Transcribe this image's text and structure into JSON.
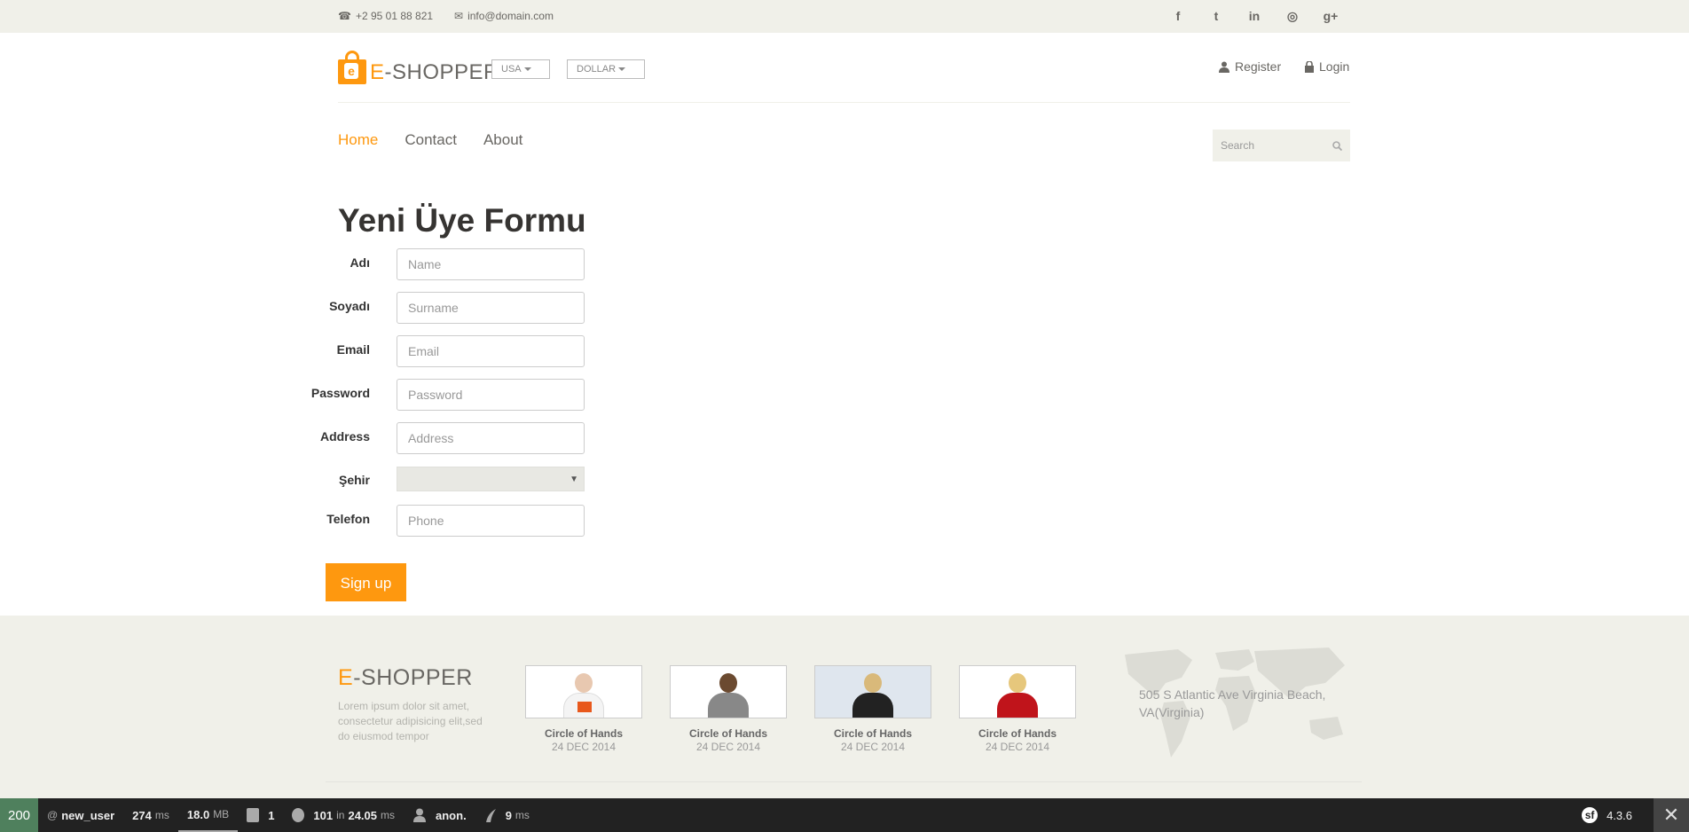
{
  "topbar": {
    "phone": "+2 95 01 88 821",
    "email": "info@domain.com",
    "socials": [
      "facebook-icon",
      "twitter-icon",
      "linkedin-icon",
      "dribbble-icon",
      "google-plus-icon"
    ],
    "social_glyphs": [
      "f",
      "t",
      "in",
      "◎",
      "g+"
    ]
  },
  "header": {
    "logo_letter": "e",
    "logo_prefix": "E",
    "logo_suffix": "-SHOPPER",
    "country": "USA",
    "currency": "DOLLAR",
    "register": "Register",
    "login": "Login"
  },
  "nav": {
    "home": "Home",
    "contact": "Contact",
    "about": "About"
  },
  "search": {
    "placeholder": "Search"
  },
  "form": {
    "title": "Yeni Üye Formu",
    "fields": [
      {
        "label": "Adı",
        "placeholder": "Name"
      },
      {
        "label": "Soyadı",
        "placeholder": "Surname"
      },
      {
        "label": "Email",
        "placeholder": "Email"
      },
      {
        "label": "Password",
        "placeholder": "Password"
      },
      {
        "label": "Address",
        "placeholder": "Address"
      }
    ],
    "city_label": "Şehir",
    "phone_label": "Telefon",
    "phone_placeholder": "Phone",
    "submit": "Sign up"
  },
  "footer": {
    "logo_prefix": "E",
    "logo_suffix": "-SHOPPER",
    "description": "Lorem ipsum dolor sit amet, consectetur adipisicing elit,sed do eiusmod tempor",
    "videos": [
      {
        "title": "Circle of Hands",
        "date": "24 DEC 2014"
      },
      {
        "title": "Circle of Hands",
        "date": "24 DEC 2014"
      },
      {
        "title": "Circle of Hands",
        "date": "24 DEC 2014"
      },
      {
        "title": "Circle of Hands",
        "date": "24 DEC 2014"
      }
    ],
    "address": "505 S Atlantic Ave Virginia Beach, VA(Virginia)"
  },
  "debugbar": {
    "status": "200",
    "route_prefix": "@",
    "route": "new_user",
    "time": "274",
    "time_unit": "ms",
    "memory": "18.0",
    "memory_unit": "MB",
    "logs": "1",
    "queries": "101",
    "queries_in": "in",
    "query_time": "24.05",
    "query_unit": "ms",
    "user": "anon.",
    "twig_time": "9",
    "twig_unit": "ms",
    "version": "4.3.6",
    "sf_glyph": "sf",
    "close_glyph": "✕"
  },
  "colors": {
    "accent": "#fe980f",
    "topbar": "#f0f0e9",
    "debug_ok": "#4f805d"
  }
}
